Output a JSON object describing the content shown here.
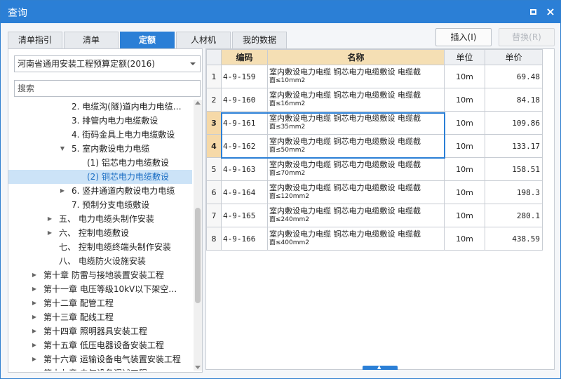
{
  "window": {
    "title": "查询",
    "maximize_icon": "maximize-icon",
    "close_icon": "close-icon",
    "close_glyph": "×"
  },
  "tabs": [
    {
      "label": "清单指引",
      "active": false
    },
    {
      "label": "清单",
      "active": false
    },
    {
      "label": "定额",
      "active": true
    },
    {
      "label": "人材机",
      "active": false
    },
    {
      "label": "我的数据",
      "active": false
    }
  ],
  "toolbar": {
    "insert_label": "插入(I)",
    "replace_label": "替换(R)"
  },
  "left": {
    "library_selected": "河南省通用安装工程预算定额(2016)",
    "search_placeholder": "搜索",
    "tree": [
      {
        "label": "2. 电缆沟(隧)道内电力电缆…",
        "arrow": "",
        "level": 4
      },
      {
        "label": "3. 排管内电力电缆敷设",
        "arrow": "",
        "level": 4
      },
      {
        "label": "4. 街码金具上电力电缆敷设",
        "arrow": "",
        "level": 4
      },
      {
        "label": "5. 室内敷设电力电缆",
        "arrow": "▼",
        "level": 4
      },
      {
        "label": "(1) 铝芯电力电缆敷设",
        "arrow": "",
        "level": 5
      },
      {
        "label": "(2) 铜芯电力电缆敷设",
        "arrow": "",
        "level": 5,
        "selected": true
      },
      {
        "label": "6. 竖井通道内敷设电力电缆",
        "arrow": "▶",
        "level": 4
      },
      {
        "label": "7. 预制分支电缆敷设",
        "arrow": "",
        "level": 4
      },
      {
        "label": "五、 电力电缆头制作安装",
        "arrow": "▶",
        "level": 3
      },
      {
        "label": "六、 控制电缆敷设",
        "arrow": "▶",
        "level": 3
      },
      {
        "label": "七、 控制电缆终端头制作安装",
        "arrow": "",
        "level": 3
      },
      {
        "label": "八、 电缆防火设施安装",
        "arrow": "",
        "level": 3
      },
      {
        "label": "第十章 防雷与接地装置安装工程",
        "arrow": "▶",
        "level": 2
      },
      {
        "label": "第十一章 电压等级10kV以下架空…",
        "arrow": "▶",
        "level": 2
      },
      {
        "label": "第十二章 配管工程",
        "arrow": "▶",
        "level": 2
      },
      {
        "label": "第十三章 配线工程",
        "arrow": "▶",
        "level": 2
      },
      {
        "label": "第十四章 照明器具安装工程",
        "arrow": "▶",
        "level": 2
      },
      {
        "label": "第十五章 低压电器设备安装工程",
        "arrow": "▶",
        "level": 2
      },
      {
        "label": "第十六章 运输设备电气装置安装工程",
        "arrow": "▶",
        "level": 2
      },
      {
        "label": "第十七章 电气设备调试工程",
        "arrow": "▶",
        "level": 2
      }
    ]
  },
  "grid": {
    "headers": {
      "code": "编码",
      "name": "名称",
      "unit": "单位",
      "price": "单价"
    },
    "rows": [
      {
        "num": "1",
        "code": "4-9-159",
        "name1": "室内敷设电力电缆 铜芯电力电缆敷设 电缆截",
        "name2": "面≤10mm2",
        "unit": "10m",
        "price": "69.48"
      },
      {
        "num": "2",
        "code": "4-9-160",
        "name1": "室内敷设电力电缆 铜芯电力电缆敷设 电缆截",
        "name2": "面≤16mm2",
        "unit": "10m",
        "price": "84.18"
      },
      {
        "num": "3",
        "code": "4-9-161",
        "name1": "室内敷设电力电缆 铜芯电力电缆敷设 电缆截",
        "name2": "面≤35mm2",
        "unit": "10m",
        "price": "109.86",
        "highlight": true
      },
      {
        "num": "4",
        "code": "4-9-162",
        "name1": "室内敷设电力电缆 铜芯电力电缆敷设 电缆截",
        "name2": "面≤50mm2",
        "unit": "10m",
        "price": "133.17",
        "highlight": true
      },
      {
        "num": "5",
        "code": "4-9-163",
        "name1": "室内敷设电力电缆 铜芯电力电缆敷设 电缆截",
        "name2": "面≤70mm2",
        "unit": "10m",
        "price": "158.51"
      },
      {
        "num": "6",
        "code": "4-9-164",
        "name1": "室内敷设电力电缆 铜芯电力电缆敷设 电缆截",
        "name2": "面≤120mm2",
        "unit": "10m",
        "price": "198.3"
      },
      {
        "num": "7",
        "code": "4-9-165",
        "name1": "室内敷设电力电缆 铜芯电力电缆敷设 电缆截",
        "name2": "面≤240mm2",
        "unit": "10m",
        "price": "280.1"
      },
      {
        "num": "8",
        "code": "4-9-166",
        "name1": "室内敷设电力电缆 铜芯电力电缆敷设 电缆截",
        "name2": "面≤400mm2",
        "unit": "10m",
        "price": "438.59"
      }
    ]
  },
  "colors": {
    "accent": "#2b7fd6",
    "header_bg": "#f5dfb4",
    "selected_row_num": "#f6d9a8",
    "tree_selected_bg": "#cce3f7"
  }
}
